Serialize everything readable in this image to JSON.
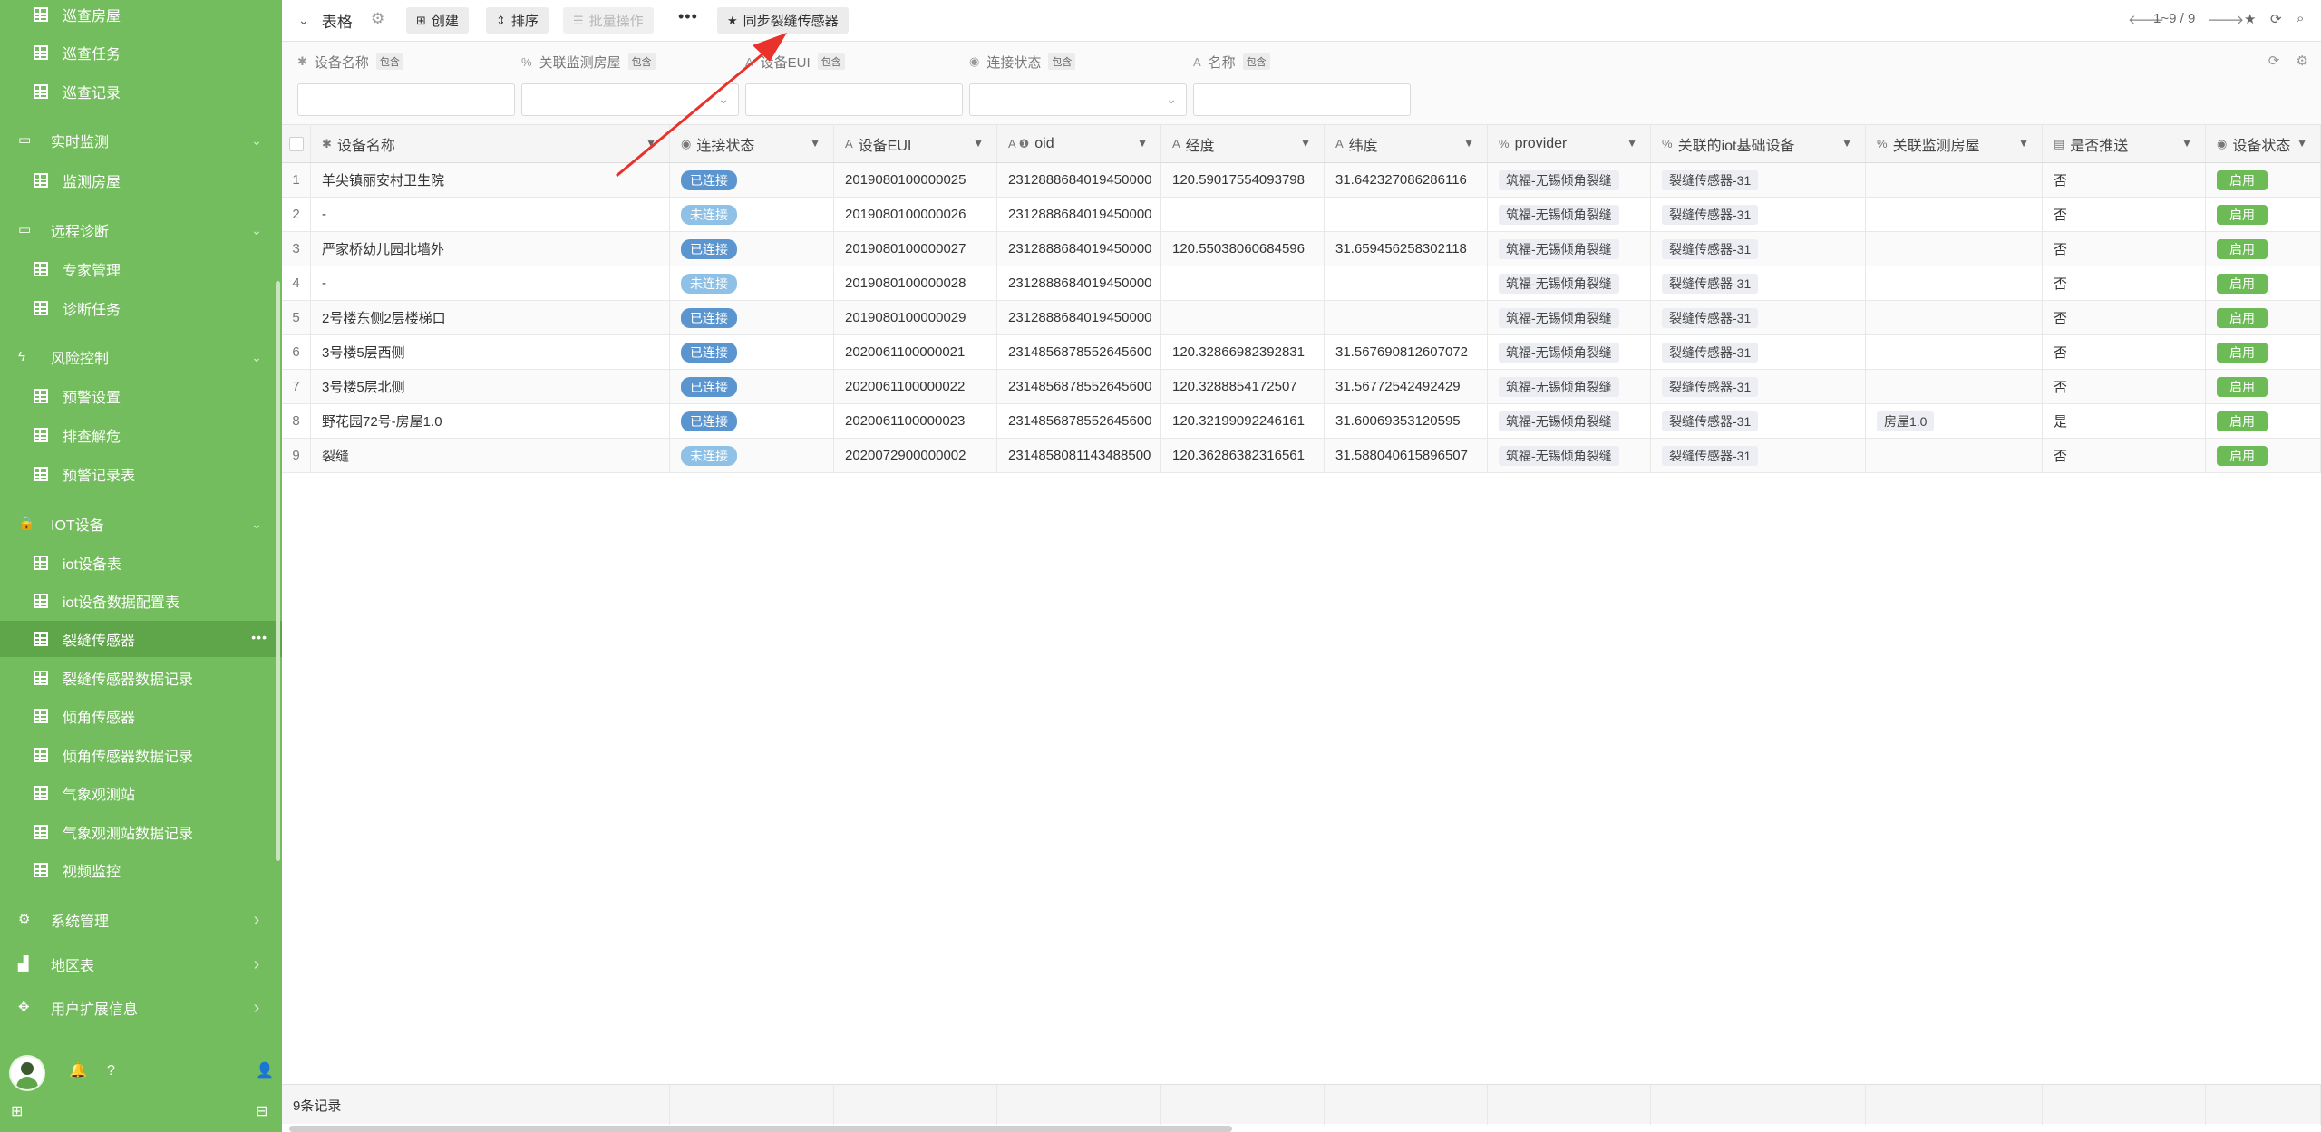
{
  "sidebar": {
    "items": [
      {
        "label": "巡查房屋",
        "kind": "child",
        "icon": "grid-icon"
      },
      {
        "label": "巡查任务",
        "kind": "child",
        "icon": "grid-icon"
      },
      {
        "label": "巡查记录",
        "kind": "child",
        "icon": "grid-icon"
      },
      {
        "label": "实时监测",
        "kind": "section",
        "icon": "monitor-icon",
        "expanded": true
      },
      {
        "label": "监测房屋",
        "kind": "child",
        "icon": "grid-icon"
      },
      {
        "label": "远程诊断",
        "kind": "section",
        "icon": "desktop-icon",
        "expanded": true
      },
      {
        "label": "专家管理",
        "kind": "child",
        "icon": "grid-icon"
      },
      {
        "label": "诊断任务",
        "kind": "child",
        "icon": "grid-icon"
      },
      {
        "label": "风险控制",
        "kind": "section",
        "icon": "bolt-icon",
        "expanded": true
      },
      {
        "label": "预警设置",
        "kind": "child",
        "icon": "grid-icon"
      },
      {
        "label": "排查解危",
        "kind": "child",
        "icon": "grid-icon"
      },
      {
        "label": "预警记录表",
        "kind": "child",
        "icon": "grid-icon"
      },
      {
        "label": "IOT设备",
        "kind": "section",
        "icon": "lock-icon",
        "expanded": true
      },
      {
        "label": "iot设备表",
        "kind": "child",
        "icon": "grid-icon"
      },
      {
        "label": "iot设备数据配置表",
        "kind": "child",
        "icon": "grid-icon"
      },
      {
        "label": "裂缝传感器",
        "kind": "child",
        "icon": "grid-icon",
        "active": true
      },
      {
        "label": "裂缝传感器数据记录",
        "kind": "child",
        "icon": "grid-icon"
      },
      {
        "label": "倾角传感器",
        "kind": "child",
        "icon": "grid-icon"
      },
      {
        "label": "倾角传感器数据记录",
        "kind": "child",
        "icon": "grid-icon"
      },
      {
        "label": "气象观测站",
        "kind": "child",
        "icon": "grid-icon"
      },
      {
        "label": "气象观测站数据记录",
        "kind": "child",
        "icon": "grid-icon"
      },
      {
        "label": "视频监控",
        "kind": "child",
        "icon": "grid-icon"
      },
      {
        "label": "系统管理",
        "kind": "section",
        "icon": "cogs-icon",
        "expanded": false
      },
      {
        "label": "地区表",
        "kind": "section",
        "icon": "area-chart-icon",
        "expanded": false
      },
      {
        "label": "用户扩展信息",
        "kind": "section",
        "icon": "arrows-icon",
        "expanded": false
      }
    ],
    "active_dots": "•••",
    "accent": "#74bd5e"
  },
  "toolbar": {
    "title": "表格",
    "buttons": [
      {
        "label": "创建",
        "icon": "plus-square-icon"
      },
      {
        "label": "排序",
        "icon": "sort-icon"
      },
      {
        "label": "批量操作",
        "icon": "list-icon",
        "disabled": true
      },
      {
        "label": "同步裂缝传感器",
        "icon": "star-icon"
      }
    ],
    "more": "•••",
    "pagination": "1~9 / 9"
  },
  "filters": [
    {
      "label": "设备名称",
      "op": "包含",
      "icon": "asterisk-icon",
      "type": "text"
    },
    {
      "label": "关联监测房屋",
      "op": "包含",
      "icon": "link-icon",
      "type": "select"
    },
    {
      "label": "设备EUI",
      "op": "包含",
      "icon": "font-icon",
      "type": "text"
    },
    {
      "label": "连接状态",
      "op": "包含",
      "icon": "check-circle-icon",
      "type": "select"
    },
    {
      "label": "名称",
      "op": "包含",
      "icon": "font-icon",
      "type": "text"
    }
  ],
  "table": {
    "columns": [
      {
        "label": "设备名称",
        "icon": "✱"
      },
      {
        "label": "连接状态",
        "icon": "◉"
      },
      {
        "label": "设备EUI",
        "icon": "A"
      },
      {
        "label": "oid",
        "icon": "A ❶"
      },
      {
        "label": "经度",
        "icon": "A"
      },
      {
        "label": "纬度",
        "icon": "A"
      },
      {
        "label": "provider",
        "icon": "%"
      },
      {
        "label": "关联的iot基础设备",
        "icon": "%"
      },
      {
        "label": "关联监测房屋",
        "icon": "%"
      },
      {
        "label": "是否推送",
        "icon": "▤"
      },
      {
        "label": "设备状态",
        "icon": "◉"
      }
    ],
    "rows": [
      {
        "n": "1",
        "name": "羊尖镇丽安村卫生院",
        "status": "已连接",
        "eui": "2019080100000025",
        "oid": "2312888684019450000",
        "lng": "120.59017554093798",
        "lat": "31.642327086286116",
        "provider": "筑福-无锡倾角裂缝",
        "iot": "裂缝传感器-31",
        "house": "",
        "push": "否",
        "state": "启用"
      },
      {
        "n": "2",
        "name": "-",
        "status": "未连接",
        "eui": "2019080100000026",
        "oid": "2312888684019450000",
        "lng": "",
        "lat": "",
        "provider": "筑福-无锡倾角裂缝",
        "iot": "裂缝传感器-31",
        "house": "",
        "push": "否",
        "state": "启用"
      },
      {
        "n": "3",
        "name": "严家桥幼儿园北墙外",
        "status": "已连接",
        "eui": "2019080100000027",
        "oid": "2312888684019450000",
        "lng": "120.55038060684596",
        "lat": "31.659456258302118",
        "provider": "筑福-无锡倾角裂缝",
        "iot": "裂缝传感器-31",
        "house": "",
        "push": "否",
        "state": "启用"
      },
      {
        "n": "4",
        "name": "-",
        "status": "未连接",
        "eui": "2019080100000028",
        "oid": "2312888684019450000",
        "lng": "",
        "lat": "",
        "provider": "筑福-无锡倾角裂缝",
        "iot": "裂缝传感器-31",
        "house": "",
        "push": "否",
        "state": "启用"
      },
      {
        "n": "5",
        "name": "2号楼东侧2层楼梯口",
        "status": "已连接",
        "eui": "2019080100000029",
        "oid": "2312888684019450000",
        "lng": "",
        "lat": "",
        "provider": "筑福-无锡倾角裂缝",
        "iot": "裂缝传感器-31",
        "house": "",
        "push": "否",
        "state": "启用"
      },
      {
        "n": "6",
        "name": "3号楼5层西侧",
        "status": "已连接",
        "eui": "2020061100000021",
        "oid": "2314856878552645600",
        "lng": "120.32866982392831",
        "lat": "31.567690812607072",
        "provider": "筑福-无锡倾角裂缝",
        "iot": "裂缝传感器-31",
        "house": "",
        "push": "否",
        "state": "启用"
      },
      {
        "n": "7",
        "name": "3号楼5层北侧",
        "status": "已连接",
        "eui": "2020061100000022",
        "oid": "2314856878552645600",
        "lng": "120.3288854172507",
        "lat": "31.56772542492429",
        "provider": "筑福-无锡倾角裂缝",
        "iot": "裂缝传感器-31",
        "house": "",
        "push": "否",
        "state": "启用"
      },
      {
        "n": "8",
        "name": "野花园72号-房屋1.0",
        "status": "已连接",
        "eui": "2020061100000023",
        "oid": "2314856878552645600",
        "lng": "120.32199092246161",
        "lat": "31.60069353120595",
        "provider": "筑福-无锡倾角裂缝",
        "iot": "裂缝传感器-31",
        "house": "房屋1.0",
        "push": "是",
        "state": "启用"
      },
      {
        "n": "9",
        "name": "裂缝",
        "status": "未连接",
        "eui": "2020072900000002",
        "oid": "2314858081143488500",
        "lng": "120.36286382316561",
        "lat": "31.588040615896507",
        "provider": "筑福-无锡倾角裂缝",
        "iot": "裂缝传感器-31",
        "house": "",
        "push": "否",
        "state": "启用"
      }
    ],
    "footer": "9条记录"
  },
  "colors": {
    "sidebar": "#74bd5e",
    "connected": "#5a95cf",
    "disconnected": "#8fc1e6",
    "enabled": "#6cbb57",
    "annotation": "#e8322b"
  }
}
